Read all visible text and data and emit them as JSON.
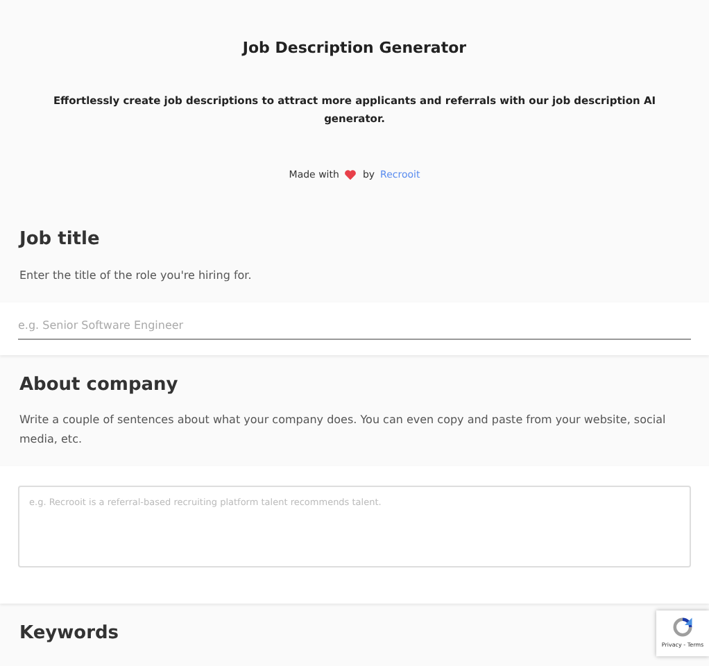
{
  "header": {
    "title": "Job Description Generator",
    "subtitle": "Effortlessly create job descriptions to attract more applicants and referrals with our job description AI generator.",
    "credit": {
      "before": "Made with",
      "after": "by",
      "link": "Recrooit"
    }
  },
  "sections": [
    {
      "kind": "input",
      "heading": "Job title",
      "description": "Enter the title of the role you're hiring for.",
      "placeholder": "e.g. Senior Software Engineer"
    },
    {
      "kind": "textarea",
      "heading": "About company",
      "description": "Write a couple of sentences about what your company does. You can even copy and paste from your website, social media, etc.",
      "placeholder": "e.g. Recrooit is a referral-based recruiting platform talent recommends talent."
    },
    {
      "kind": "none",
      "heading": "Keywords"
    }
  ],
  "recaptcha": {
    "links": "Privacy - Terms"
  }
}
